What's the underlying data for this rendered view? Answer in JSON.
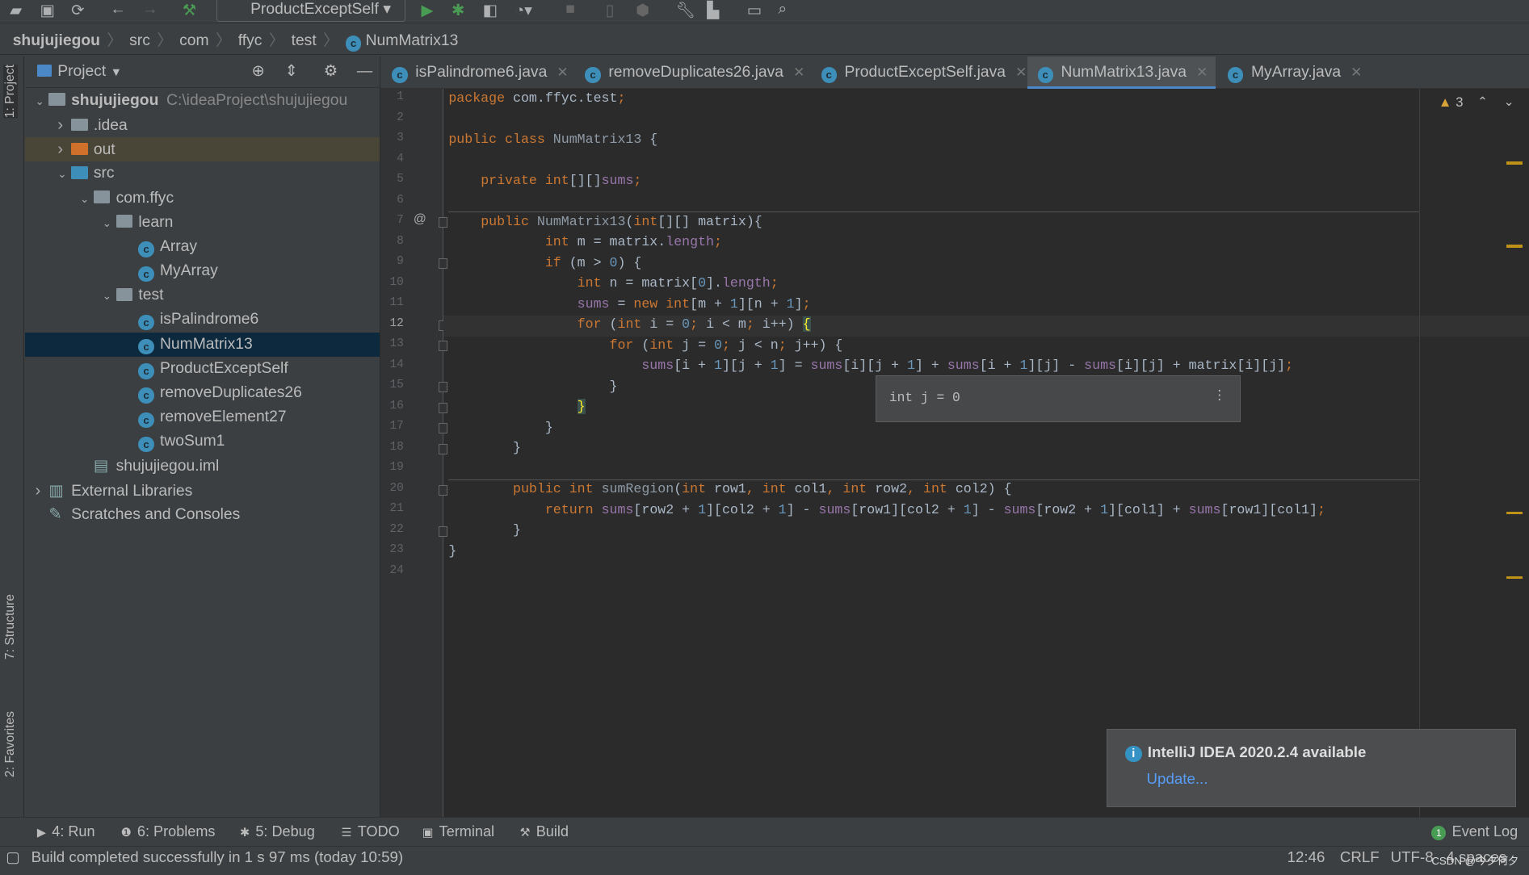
{
  "toolbar": {
    "run_config": "ProductExceptSelf",
    "icons": [
      "open-folder-icon",
      "save-icon",
      "sync-icon",
      "back-icon",
      "forward-icon",
      "build-hammer-icon",
      "run-icon",
      "debug-icon",
      "coverage-icon",
      "profile-icon",
      "stop-icon",
      "device-icon",
      "sdk-icon",
      "wrench-icon",
      "project-structure-icon",
      "terminal-window-icon",
      "search-icon"
    ]
  },
  "breadcrumb": [
    "shujujiegou",
    "src",
    "com",
    "ffyc",
    "test",
    "NumMatrix13"
  ],
  "left_strip": {
    "project": "1: Project",
    "structure": "7: Structure",
    "favorites": "2: Favorites"
  },
  "project": {
    "title": "Project",
    "tree": [
      {
        "label": "shujujiegou",
        "path": "C:\\ideaProject\\shujujiegou",
        "level": 0,
        "arrow": "down",
        "icon": "module-folder",
        "bold": true
      },
      {
        "label": ".idea",
        "level": 1,
        "arrow": "right",
        "icon": "folder"
      },
      {
        "label": "out",
        "level": 1,
        "arrow": "right",
        "icon": "folder-orange",
        "state": "out"
      },
      {
        "label": "src",
        "level": 1,
        "arrow": "down",
        "icon": "folder-blue"
      },
      {
        "label": "com.ffyc",
        "level": 2,
        "arrow": "down",
        "icon": "package"
      },
      {
        "label": "learn",
        "level": 3,
        "arrow": "down",
        "icon": "package"
      },
      {
        "label": "Array",
        "level": 4,
        "icon": "class"
      },
      {
        "label": "MyArray",
        "level": 4,
        "icon": "class"
      },
      {
        "label": "test",
        "level": 3,
        "arrow": "down",
        "icon": "package"
      },
      {
        "label": "isPalindrome6",
        "level": 4,
        "icon": "class"
      },
      {
        "label": "NumMatrix13",
        "level": 4,
        "icon": "class",
        "state": "sel"
      },
      {
        "label": "ProductExceptSelf",
        "level": 4,
        "icon": "class"
      },
      {
        "label": "removeDuplicates26",
        "level": 4,
        "icon": "class"
      },
      {
        "label": "removeElement27",
        "level": 4,
        "icon": "class"
      },
      {
        "label": "twoSum1",
        "level": 4,
        "icon": "class"
      },
      {
        "label": "shujujiegou.iml",
        "level": 2,
        "icon": "iml"
      },
      {
        "label": "External Libraries",
        "level": 0,
        "arrow": "right",
        "icon": "libraries"
      },
      {
        "label": "Scratches and Consoles",
        "level": 0,
        "icon": "scratches"
      }
    ]
  },
  "tabs": [
    {
      "label": "isPalindrome6.java"
    },
    {
      "label": "removeDuplicates26.java"
    },
    {
      "label": "ProductExceptSelf.java"
    },
    {
      "label": "NumMatrix13.java",
      "active": true
    },
    {
      "label": "MyArray.java"
    }
  ],
  "editor": {
    "warnings": "3",
    "current_line": 12,
    "lines": [
      [
        [
          "package",
          "kw"
        ],
        [
          " com.ffyc.test",
          ""
        ],
        [
          ";",
          "kw"
        ]
      ],
      [],
      [
        [
          "public class ",
          "kw"
        ],
        [
          "NumMatrix13",
          "dim"
        ],
        [
          " {",
          ""
        ]
      ],
      [],
      [
        [
          "    ",
          ""
        ],
        [
          "private int",
          "kw"
        ],
        [
          "[][]",
          ""
        ],
        [
          "sums",
          "fld"
        ],
        [
          ";",
          "kw"
        ]
      ],
      [],
      [
        [
          "    ",
          ""
        ],
        [
          "public ",
          "kw"
        ],
        [
          "NumMatrix13",
          "dim"
        ],
        [
          "(",
          ""
        ],
        [
          "int",
          "kw"
        ],
        [
          "[][] matrix){",
          ""
        ]
      ],
      [
        [
          "            ",
          ""
        ],
        [
          "int ",
          "kw"
        ],
        [
          "m = matrix.",
          ""
        ],
        [
          "length",
          "fld"
        ],
        [
          ";",
          "kw"
        ]
      ],
      [
        [
          "            ",
          ""
        ],
        [
          "if ",
          "kw"
        ],
        [
          "(m > ",
          ""
        ],
        [
          "0",
          "num"
        ],
        [
          ") {",
          ""
        ]
      ],
      [
        [
          "                ",
          ""
        ],
        [
          "int ",
          "kw"
        ],
        [
          "n = matrix[",
          ""
        ],
        [
          "0",
          "num"
        ],
        [
          "].",
          ""
        ],
        [
          "length",
          "fld"
        ],
        [
          ";",
          "kw"
        ]
      ],
      [
        [
          "                ",
          ""
        ],
        [
          "sums",
          "fld"
        ],
        [
          " = ",
          ""
        ],
        [
          "new int",
          "kw"
        ],
        [
          "[m + ",
          ""
        ],
        [
          "1",
          "num"
        ],
        [
          "][n + ",
          ""
        ],
        [
          "1",
          "num"
        ],
        [
          "]",
          ""
        ],
        [
          ";",
          "kw"
        ]
      ],
      [
        [
          "                ",
          ""
        ],
        [
          "for ",
          "kw"
        ],
        [
          "(",
          ""
        ],
        [
          "int ",
          "kw"
        ],
        [
          "i = ",
          ""
        ],
        [
          "0",
          "num"
        ],
        [
          "; ",
          "kw"
        ],
        [
          "i < m",
          ""
        ],
        [
          "; ",
          "kw"
        ],
        [
          "i++) ",
          ""
        ],
        [
          "{",
          "brace"
        ]
      ],
      [
        [
          "                    ",
          ""
        ],
        [
          "for ",
          "kw"
        ],
        [
          "(",
          ""
        ],
        [
          "int ",
          "kw"
        ],
        [
          "j = ",
          ""
        ],
        [
          "0",
          "num"
        ],
        [
          "; ",
          "kw"
        ],
        [
          "j < n",
          ""
        ],
        [
          "; ",
          "kw"
        ],
        [
          "j++) {",
          ""
        ]
      ],
      [
        [
          "                        ",
          ""
        ],
        [
          "sums",
          "fld"
        ],
        [
          "[i + ",
          ""
        ],
        [
          "1",
          "num"
        ],
        [
          "][j + ",
          ""
        ],
        [
          "1",
          "num"
        ],
        [
          "] = ",
          ""
        ],
        [
          "sums",
          "fld"
        ],
        [
          "[i][j + ",
          ""
        ],
        [
          "1",
          "num"
        ],
        [
          "] + ",
          ""
        ],
        [
          "sums",
          "fld"
        ],
        [
          "[i + ",
          ""
        ],
        [
          "1",
          "num"
        ],
        [
          "][j] - ",
          ""
        ],
        [
          "sums",
          "fld"
        ],
        [
          "[i][j] + matrix[i][j]",
          ""
        ],
        [
          ";",
          "kw"
        ]
      ],
      [
        [
          "                    }",
          ""
        ]
      ],
      [
        [
          "                ",
          ""
        ],
        [
          "}",
          "brace"
        ]
      ],
      [
        [
          "            }",
          ""
        ]
      ],
      [
        [
          "        }",
          ""
        ]
      ],
      [],
      [
        [
          "        ",
          ""
        ],
        [
          "public int ",
          "kw"
        ],
        [
          "sumRegion",
          "dim"
        ],
        [
          "(",
          ""
        ],
        [
          "int ",
          "kw"
        ],
        [
          "row1",
          ""
        ],
        [
          ", ",
          "kw"
        ],
        [
          "int ",
          "kw"
        ],
        [
          "col1",
          ""
        ],
        [
          ", ",
          "kw"
        ],
        [
          "int ",
          "kw"
        ],
        [
          "row2",
          ""
        ],
        [
          ", ",
          "kw"
        ],
        [
          "int ",
          "kw"
        ],
        [
          "col2) {",
          ""
        ]
      ],
      [
        [
          "            ",
          ""
        ],
        [
          "return ",
          "kw"
        ],
        [
          "sums",
          "fld"
        ],
        [
          "[row2 + ",
          ""
        ],
        [
          "1",
          "num"
        ],
        [
          "][col2 + ",
          ""
        ],
        [
          "1",
          "num"
        ],
        [
          "] - ",
          ""
        ],
        [
          "sums",
          "fld"
        ],
        [
          "[row1][col2 + ",
          ""
        ],
        [
          "1",
          "num"
        ],
        [
          "] - ",
          ""
        ],
        [
          "sums",
          "fld"
        ],
        [
          "[row2 + ",
          ""
        ],
        [
          "1",
          "num"
        ],
        [
          "][col1] + ",
          ""
        ],
        [
          "sums",
          "fld"
        ],
        [
          "[row1][col1]",
          ""
        ],
        [
          ";",
          "kw"
        ]
      ],
      [
        [
          "        }",
          ""
        ]
      ],
      [
        [
          "}",
          ""
        ]
      ],
      []
    ],
    "tooltip": "int j = 0"
  },
  "notification": {
    "title": "IntelliJ IDEA 2020.2.4 available",
    "link": "Update..."
  },
  "bottom_tools": [
    {
      "label": "4: Run",
      "icon": "run-icon"
    },
    {
      "label": "6: Problems",
      "icon": "problems-icon"
    },
    {
      "label": "5: Debug",
      "icon": "debug-icon"
    },
    {
      "label": "TODO",
      "icon": "todo-icon"
    },
    {
      "label": "Terminal",
      "icon": "terminal-icon"
    },
    {
      "label": "Build",
      "icon": "build-icon"
    }
  ],
  "event_log": {
    "label": "Event Log",
    "count": "1"
  },
  "status": {
    "message": "Build completed successfully in 1 s 97 ms (today 10:59)",
    "position": "12:46",
    "line_sep": "CRLF",
    "encoding": "UTF-8",
    "indent": "4 spaces",
    "watermark": "CSDN @今夕何夕"
  },
  "colors": {
    "keyword": "#cc7832",
    "field": "#9876aa",
    "number": "#6897bb",
    "text": "#a9b7c6",
    "accent": "#4a88c7"
  }
}
